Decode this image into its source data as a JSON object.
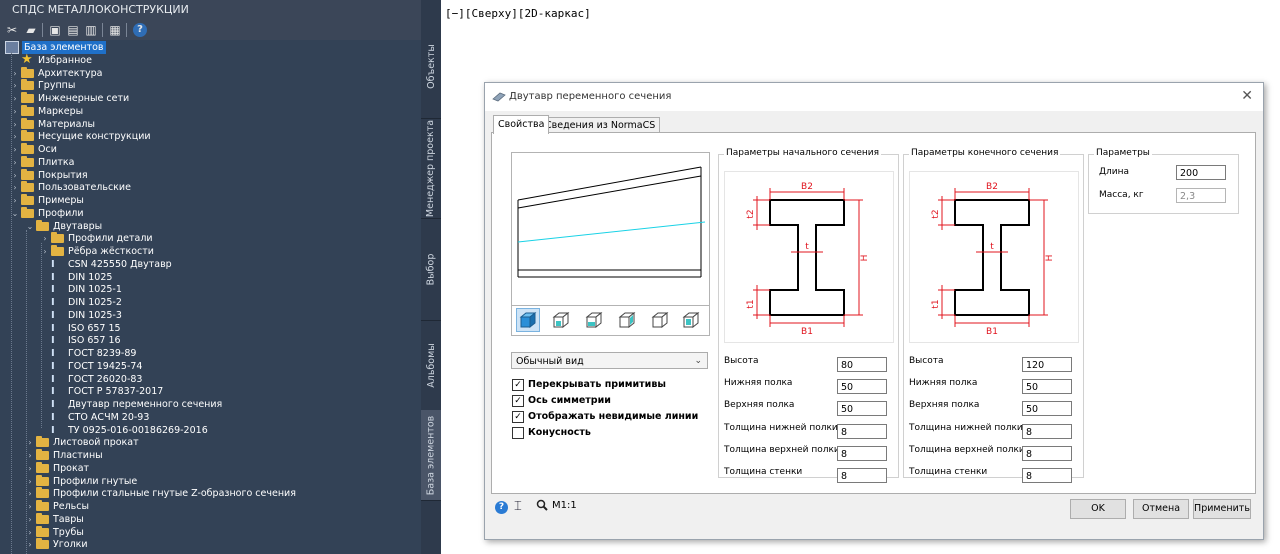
{
  "left_panel": {
    "title": "СПДС МЕТАЛЛОКОНСТРУКЦИИ",
    "toolbar_icons": [
      "tools-icon",
      "open-folder-icon",
      "objects-icon",
      "export-icon",
      "report-icon",
      "delete-icon",
      "help-icon"
    ],
    "tree": [
      {
        "label": "База элементов",
        "icon": "root",
        "depth": 0,
        "expanded": true,
        "selected": true
      },
      {
        "label": "Избранное",
        "icon": "star",
        "depth": 1
      },
      {
        "label": "Архитектура",
        "icon": "folder",
        "depth": 1,
        "arrow": true
      },
      {
        "label": "Группы",
        "icon": "folder",
        "depth": 1,
        "arrow": true
      },
      {
        "label": "Инженерные сети",
        "icon": "folder",
        "depth": 1,
        "arrow": true
      },
      {
        "label": "Маркеры",
        "icon": "folder",
        "depth": 1,
        "arrow": true
      },
      {
        "label": "Материалы",
        "icon": "folder",
        "depth": 1,
        "arrow": true
      },
      {
        "label": "Несущие конструкции",
        "icon": "folder",
        "depth": 1,
        "arrow": true
      },
      {
        "label": "Оси",
        "icon": "folder",
        "depth": 1,
        "arrow": true
      },
      {
        "label": "Плитка",
        "icon": "folder",
        "depth": 1,
        "arrow": true
      },
      {
        "label": "Покрытия",
        "icon": "folder",
        "depth": 1,
        "arrow": true
      },
      {
        "label": "Пользовательские",
        "icon": "folder",
        "depth": 1,
        "arrow": true
      },
      {
        "label": "Примеры",
        "icon": "folder",
        "depth": 1,
        "arrow": true
      },
      {
        "label": "Профили",
        "icon": "folder",
        "depth": 1,
        "arrow": true,
        "expanded": true
      },
      {
        "label": "Двутавры",
        "icon": "folder",
        "depth": 2,
        "arrow": true,
        "expanded": true
      },
      {
        "label": "Профили детали",
        "icon": "folder",
        "depth": 3,
        "arrow": true
      },
      {
        "label": "Рёбра жёсткости",
        "icon": "folder",
        "depth": 3,
        "arrow": true
      },
      {
        "label": "CSN 425550 Двутавр",
        "icon": "profile",
        "depth": 3
      },
      {
        "label": "DIN 1025",
        "icon": "profile",
        "depth": 3
      },
      {
        "label": "DIN 1025-1",
        "icon": "profile",
        "depth": 3
      },
      {
        "label": "DIN 1025-2",
        "icon": "profile",
        "depth": 3
      },
      {
        "label": "DIN 1025-3",
        "icon": "profile",
        "depth": 3
      },
      {
        "label": "ISO 657 15",
        "icon": "profile",
        "depth": 3
      },
      {
        "label": "ISO 657 16",
        "icon": "profile",
        "depth": 3
      },
      {
        "label": "ГОСТ 8239-89",
        "icon": "profile",
        "depth": 3
      },
      {
        "label": "ГОСТ 19425-74",
        "icon": "profile",
        "depth": 3
      },
      {
        "label": "ГОСТ 26020-83",
        "icon": "profile",
        "depth": 3
      },
      {
        "label": "ГОСТ Р 57837-2017",
        "icon": "profile",
        "depth": 3
      },
      {
        "label": "Двутавр переменного сечения",
        "icon": "profile",
        "depth": 3
      },
      {
        "label": "СТО АСЧМ 20-93",
        "icon": "profile",
        "depth": 3
      },
      {
        "label": "ТУ 0925-016-00186269-2016",
        "icon": "profile",
        "depth": 3
      },
      {
        "label": "Листовой прокат",
        "icon": "folder",
        "depth": 2,
        "arrow": true
      },
      {
        "label": "Пластины",
        "icon": "folder",
        "depth": 2,
        "arrow": true
      },
      {
        "label": "Прокат",
        "icon": "folder",
        "depth": 2,
        "arrow": true
      },
      {
        "label": "Профили гнутые",
        "icon": "folder",
        "depth": 2,
        "arrow": true
      },
      {
        "label": "Профили стальные гнутые Z-образного сечения",
        "icon": "folder",
        "depth": 2,
        "arrow": true
      },
      {
        "label": "Рельсы",
        "icon": "folder",
        "depth": 2,
        "arrow": true
      },
      {
        "label": "Тавры",
        "icon": "folder",
        "depth": 2,
        "arrow": true
      },
      {
        "label": "Трубы",
        "icon": "folder",
        "depth": 2,
        "arrow": true
      },
      {
        "label": "Уголки",
        "icon": "folder",
        "depth": 2,
        "arrow": true
      }
    ]
  },
  "side_tabs": [
    {
      "label": "Объекты"
    },
    {
      "label": "Менеджер проекта"
    },
    {
      "label": "Выбор"
    },
    {
      "label": "Альбомы"
    },
    {
      "label": "База элементов",
      "active": true
    }
  ],
  "viewport": {
    "label": "[−][Сверху][2D-каркас]"
  },
  "dialog": {
    "title": "Двутавр переменного сечения",
    "tabs": [
      {
        "label": "Свойства",
        "active": true
      },
      {
        "label": "Сведения из NormaCS"
      }
    ],
    "view_select": "Обычный вид",
    "checkboxes": [
      {
        "label": "Перекрывать примитивы",
        "checked": true
      },
      {
        "label": "Ось симметрии",
        "checked": true
      },
      {
        "label": "Отображать невидимые линии",
        "checked": true
      },
      {
        "label": "Конусность",
        "checked": false
      }
    ],
    "start_section": {
      "title": "Параметры начального сечения",
      "fields": [
        {
          "label": "Высота",
          "value": "80"
        },
        {
          "label": "Нижняя полка",
          "value": "50"
        },
        {
          "label": "Верхняя полка",
          "value": "50"
        },
        {
          "label": "Толщина нижней полки",
          "value": "8"
        },
        {
          "label": "Толщина верхней полки",
          "value": "8"
        },
        {
          "label": "Толщина стенки",
          "value": "8"
        }
      ]
    },
    "end_section": {
      "title": "Параметры конечного сечения",
      "fields": [
        {
          "label": "Высота",
          "value": "120"
        },
        {
          "label": "Нижняя полка",
          "value": "50"
        },
        {
          "label": "Верхняя полка",
          "value": "50"
        },
        {
          "label": "Толщина нижней полки",
          "value": "8"
        },
        {
          "label": "Толщина верхней полки",
          "value": "8"
        },
        {
          "label": "Толщина стенки",
          "value": "8"
        }
      ]
    },
    "sketch_labels": {
      "b2": "B2",
      "b1": "B1",
      "t2": "t2",
      "t1": "t1",
      "t": "t",
      "h": "H"
    },
    "params": {
      "title": "Параметры",
      "length_label": "Длина",
      "length_value": "200",
      "mass_label": "Масса, кг",
      "mass_value": "2,3"
    },
    "scale_label": "М1:1",
    "buttons": {
      "ok": "OK",
      "cancel": "Отмена",
      "apply": "Применить"
    }
  }
}
